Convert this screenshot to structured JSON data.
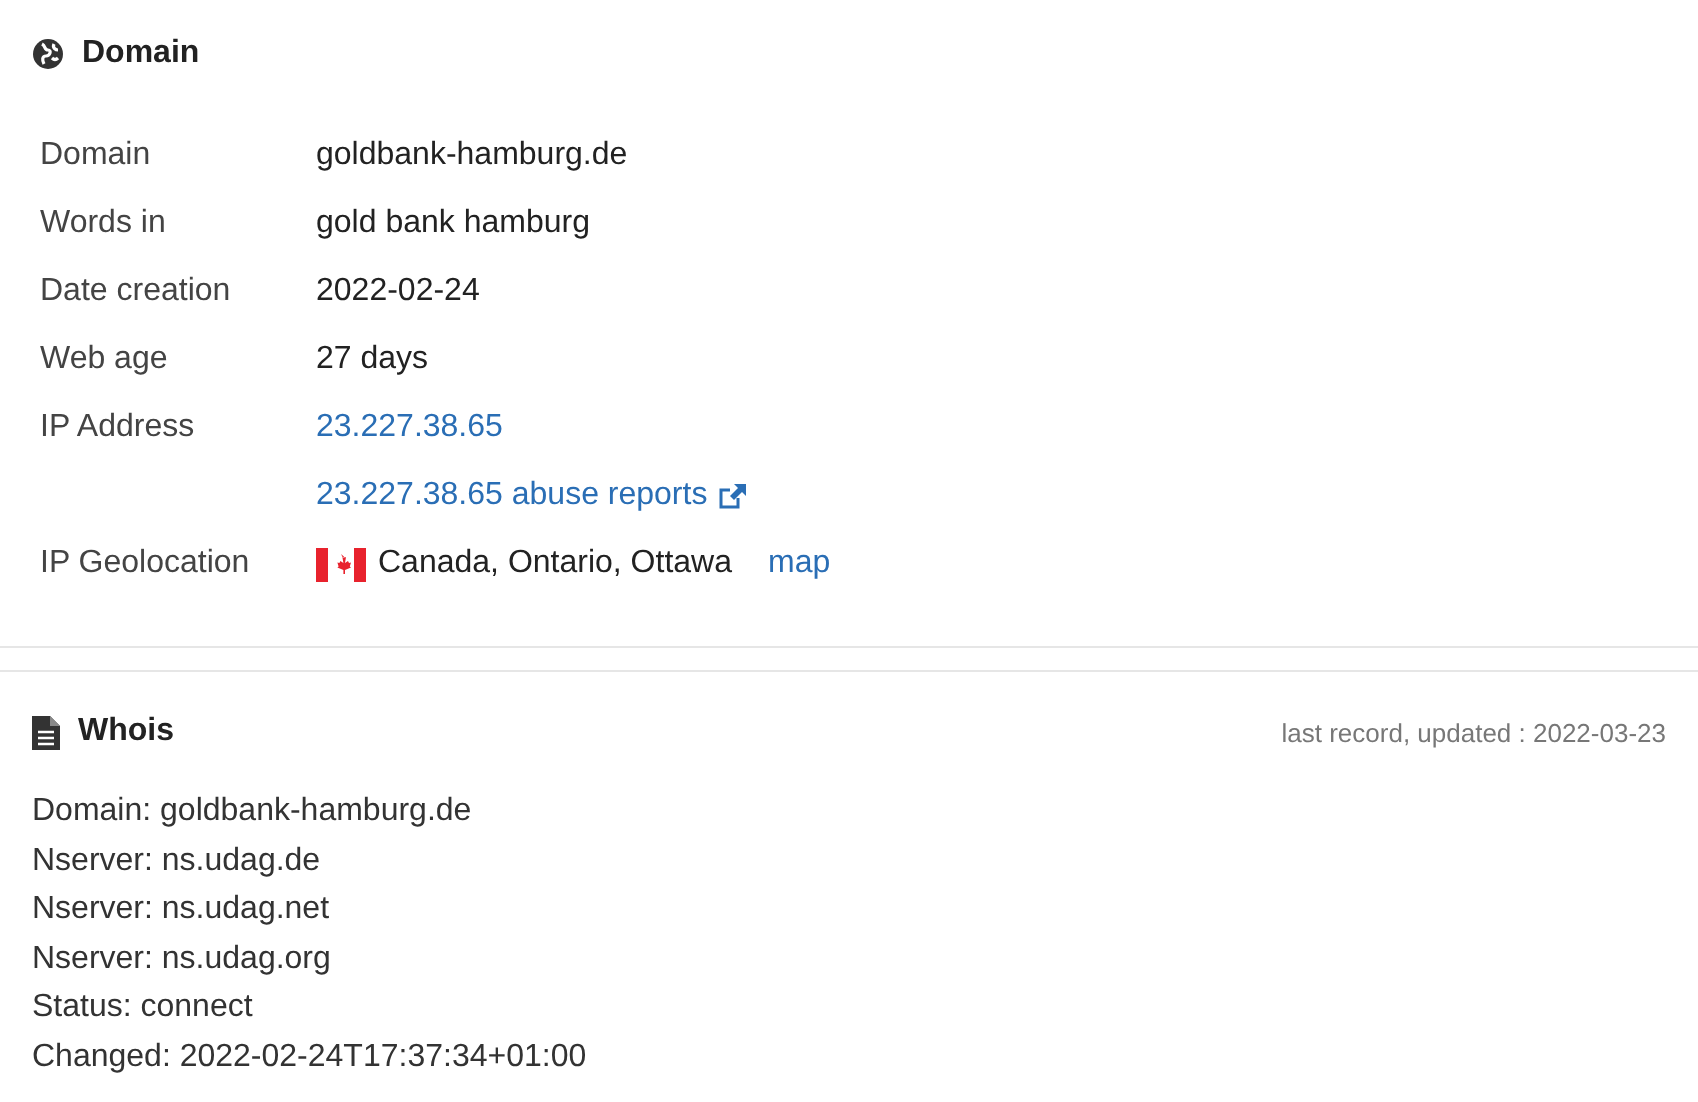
{
  "domain_section": {
    "title": "Domain",
    "rows": [
      {
        "label": "Domain",
        "kind": "text",
        "value": "goldbank-hamburg.de"
      },
      {
        "label": "Words in",
        "kind": "text",
        "value": "gold bank hamburg"
      },
      {
        "label": "Date creation",
        "kind": "text",
        "value": "2022-02-24"
      },
      {
        "label": "Web age",
        "kind": "text",
        "value": "27 days"
      },
      {
        "label": "IP Address",
        "kind": "link",
        "value": "23.227.38.65"
      },
      {
        "kind": "external_link",
        "value": "23.227.38.65 abuse reports"
      },
      {
        "label": "IP Geolocation",
        "kind": "location",
        "value": "Canada, Ontario, Ottawa",
        "link": "map"
      }
    ]
  },
  "whois_section": {
    "title": "Whois",
    "updated": "last record, updated : 2022-03-23",
    "lines": [
      "Domain: goldbank-hamburg.de",
      "Nserver: ns.udag.de",
      "Nserver: ns.udag.net",
      "Nserver: ns.udag.org",
      "Status: connect",
      "Changed: 2022-02-24T17:37:34+01:00"
    ]
  }
}
